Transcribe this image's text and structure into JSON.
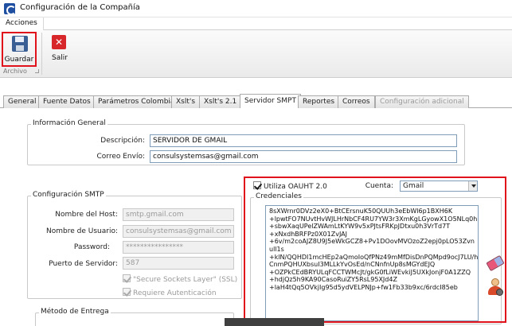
{
  "window": {
    "title": "Configuración de la Compañía"
  },
  "menu": {
    "tab": "Acciones"
  },
  "ribbon": {
    "save_label": "Guardar",
    "exit_label": "Salir",
    "group_label": "Archivo"
  },
  "tabs": [
    {
      "label": "General"
    },
    {
      "label": "Fuente Datos"
    },
    {
      "label": "Parámetros Colombia"
    },
    {
      "label": "Xslt's"
    },
    {
      "label": "Xslt's 2.1"
    },
    {
      "label": "Servidor SMPT"
    },
    {
      "label": "Reportes"
    },
    {
      "label": "Correos"
    },
    {
      "label": "Configuración adicional"
    }
  ],
  "general_info": {
    "legend": "Información General",
    "description_label": "Descripción:",
    "description_value": "SERVIDOR DE GMAIL",
    "email_label": "Correo Envío:",
    "email_value": "consulsystemsas@gmail.com"
  },
  "smtp": {
    "legend": "Configuración SMTP",
    "host_label": "Nombre del Host:",
    "host_value": "smtp.gmail.com",
    "user_label": "Nombre de Usuario:",
    "user_value": "consulsystemsas@gmail.com",
    "password_label": "Password:",
    "password_value": "****************",
    "port_label": "Puerto de Servidor:",
    "port_value": "587",
    "ssl_label": "\"Secure Sockets Layer\" (SSL)",
    "auth_label": "Requiere Autenticación"
  },
  "delivery": {
    "legend": "Método de Entrega"
  },
  "oauth": {
    "use_label": "Utiliza OAUHT 2.0",
    "account_label": "Cuenta:",
    "account_value": "Gmail",
    "credentials_legend": "Credenciales",
    "credentials_text": "8sXWrnr0DVz2eX0+BtCErsnuK50QUUh3eEbWl6p1BXH6K\n+lpwtFO7NUvtHvWJLHrNbCF4RU7YW3r3XmKgLGyowX1O5NLq0h\n+sbwXaqUPelZWAmLtKYW9v5xPJtsFRKpJDtxu0h3VrTd7T\n+xNxdhBRFPz0X01ZvJAJ\n+6v/m2coAJZ8U9J5eWkGCZ8+Pv1DOovMVOzoZ2epj0pLO53Zvn\null1s\n+klN/QQHDI1mcHEp2aQmoIoQfPNz49mMfDisDnPQMpd9ocJ7LU/h\nCnmPQHUXbsuI3MLLkYvOsEd/nCNnfnUp8sMGYdEJQ\n+OZPkCEdBRYULqFCCTWMcJt/gkG0fLiWEvkiJ5UXkJonjF0A1ZZQ\n+hdjQz5h9KA90CasoRuiZY5RsL95XJd4Z\n+laH4tQq5OVkjIg95d5ydVELPNJp+fw1Fb33b9xc/6rdcI85eb"
  }
}
